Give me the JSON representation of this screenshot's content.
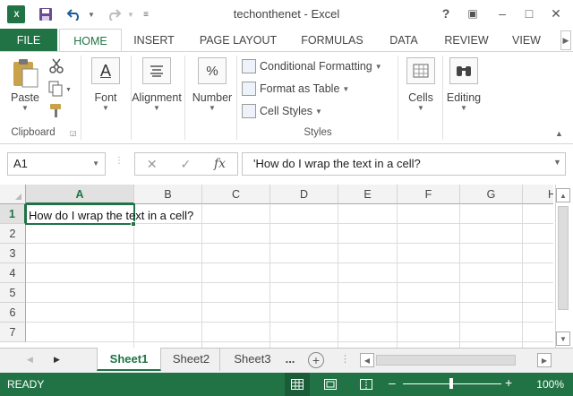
{
  "titlebar": {
    "app_icon": "X",
    "title": "techonthenet - Excel",
    "help": "?",
    "restore_ribbon": "▣",
    "minimize": "–",
    "maximize": "□",
    "close": "✕"
  },
  "tabs": [
    "FILE",
    "HOME",
    "INSERT",
    "PAGE LAYOUT",
    "FORMULAS",
    "DATA",
    "REVIEW",
    "VIEW"
  ],
  "ribbon": {
    "clipboard": {
      "paste": "Paste",
      "group": "Clipboard"
    },
    "font": {
      "label": "Font",
      "icon_letter": "A"
    },
    "alignment": {
      "label": "Alignment"
    },
    "number": {
      "label": "Number",
      "icon": "%"
    },
    "styles": {
      "conditional": "Conditional Formatting",
      "format_table": "Format as Table",
      "cell_styles": "Cell Styles",
      "group": "Styles"
    },
    "cells": {
      "label": "Cells"
    },
    "editing": {
      "label": "Editing"
    }
  },
  "formula_bar": {
    "name_box": "A1",
    "fx": "fx",
    "content": "'How do I wrap the text in a cell?"
  },
  "grid": {
    "columns": [
      "A",
      "B",
      "C",
      "D",
      "E",
      "F",
      "G",
      "H"
    ],
    "rows": [
      "1",
      "2",
      "3",
      "4",
      "5",
      "6",
      "7"
    ],
    "a1_value": "How do I wrap the text in a cell?"
  },
  "sheets": {
    "tabs": [
      "Sheet1",
      "Sheet2",
      "Sheet3"
    ],
    "more": "...",
    "add": "+"
  },
  "status": {
    "text": "READY",
    "zoom": "100%",
    "zoom_minus": "–",
    "zoom_plus": "+"
  },
  "colors": {
    "accent": "#217346"
  }
}
